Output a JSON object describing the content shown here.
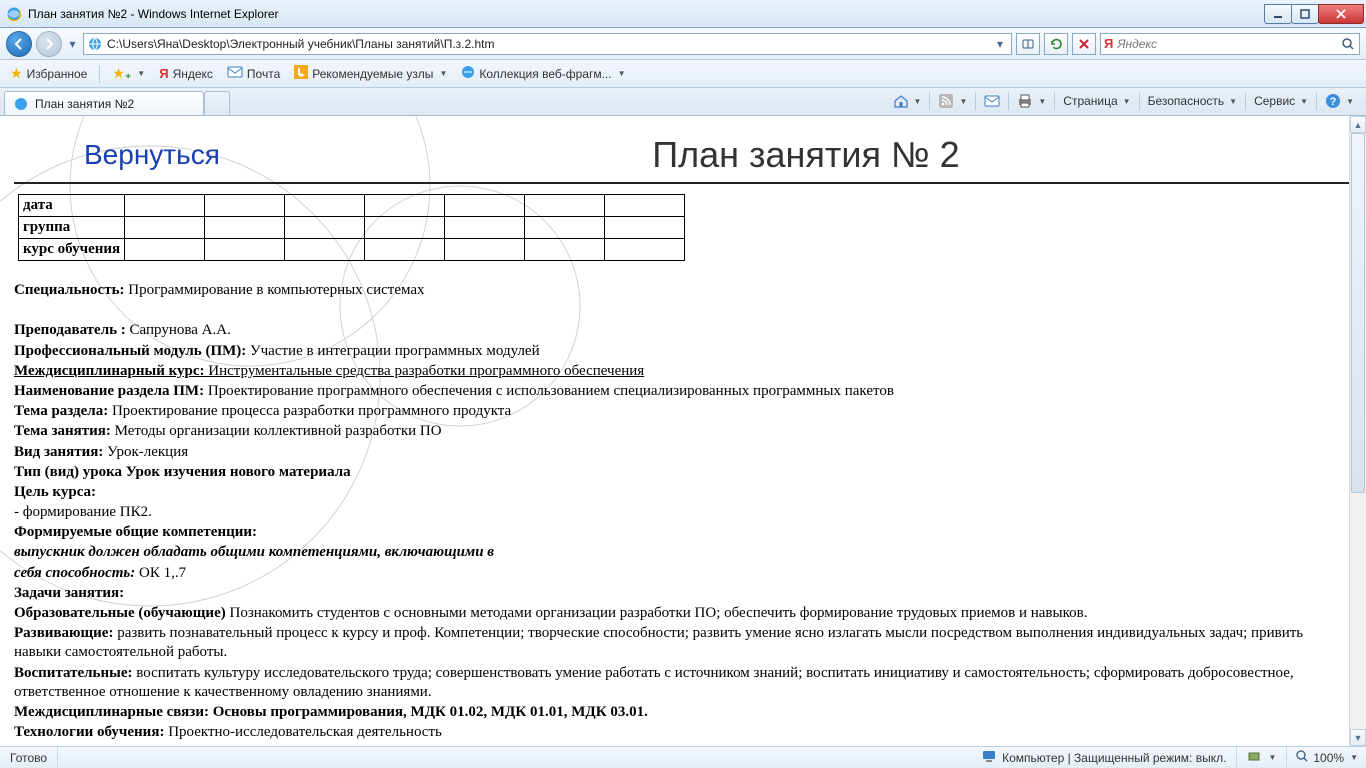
{
  "window": {
    "title": "План занятия №2 - Windows Internet Explorer"
  },
  "nav": {
    "url": "C:\\Users\\Яна\\Desktop\\Электронный учебник\\Планы занятий\\П.з.2.htm",
    "search_placeholder": "Яндекс"
  },
  "favbar": {
    "fav": "Избранное",
    "yandex": "Яндекс",
    "mail": "Почта",
    "rec": "Рекомендуемые узлы",
    "webfrag": "Коллекция веб-фрагм..."
  },
  "tab": {
    "title": "План занятия №2"
  },
  "cmd": {
    "page": "Страница",
    "security": "Безопасность",
    "service": "Сервис"
  },
  "content": {
    "back": "Вернуться",
    "title": "План занятия № 2",
    "table_rows": [
      "дата",
      "группа",
      "курс обучения"
    ],
    "spec_l": "Специальность:",
    "spec_v": " Программирование в компьютерных системах",
    "teach_l": "Преподаватель :",
    "teach_v": " Сапрунова А.А.",
    "pm_l": "Профессиональный модуль (ПМ):",
    "pm_v": "  Участие в интеграции программных модулей",
    "mdk_l": "Междисциплинарный курс:",
    "mdk_v": " Инструментальные средства разработки программного обеспечения",
    "razdel_l": "Наименование раздела ПМ:",
    "razdel_v": " Проектирование программного обеспечения с использованием специализированных программных пакетов",
    "tema_r_l": "Тема раздела:",
    "tema_r_v": " Проектирование процесса разработки программного продукта",
    "tema_z_l": "Тема занятия:",
    "tema_z_v": " Методы организации коллективной разработки ПО",
    "vid_l": "Вид занятия:",
    "vid_v": " Урок-лекция",
    "tip_l": "Тип (вид) урока",
    "tip_v": " Урок изучения нового материала",
    "goal_l": "Цель курса:",
    "goal_v": "- формирование ПК2.",
    "comp_l": "Формируемые общие компетенции:",
    "comp_i": "выпускник должен обладать общими компетенциями, включающими в",
    "comp_i2": "себя способность:",
    "comp_v": " ОК 1,.7",
    "tasks_l": "Задачи занятия:",
    "edu_l": "Образовательные (обучающие)",
    "edu_v": " Познакомить студентов с основными методами организации  разработки ПО; обеспечить формирование трудовых приемов и навыков.",
    "dev_l": "Развивающие:",
    "dev_v": " развить познавательный процесс к курсу и проф. Компетенции; творческие способности; развить умение ясно излагать мысли посредством выполнения индивидуальных задач; привить навыки самостоятельной работы.",
    "vos_l": "Воспитательные:",
    "vos_v": " воспитать культуру исследовательского труда; совершенствовать умение работать с источником знаний; воспитать инициативу и самостоятельность; сформировать добросовестное, ответственное отношение к качественному овладению знаниями.",
    "links_l": "Междисциплинарные связи:  Основы программирования, МДК 01.02, МДК 01.01, МДК 03.01.",
    "tech_l": "Технологии обучения:",
    "tech_v": " Проектно-исследовательская деятельность"
  },
  "status": {
    "ready": "Готово",
    "zone": "Компьютер | Защищенный режим: выкл.",
    "zoom": "100%"
  }
}
